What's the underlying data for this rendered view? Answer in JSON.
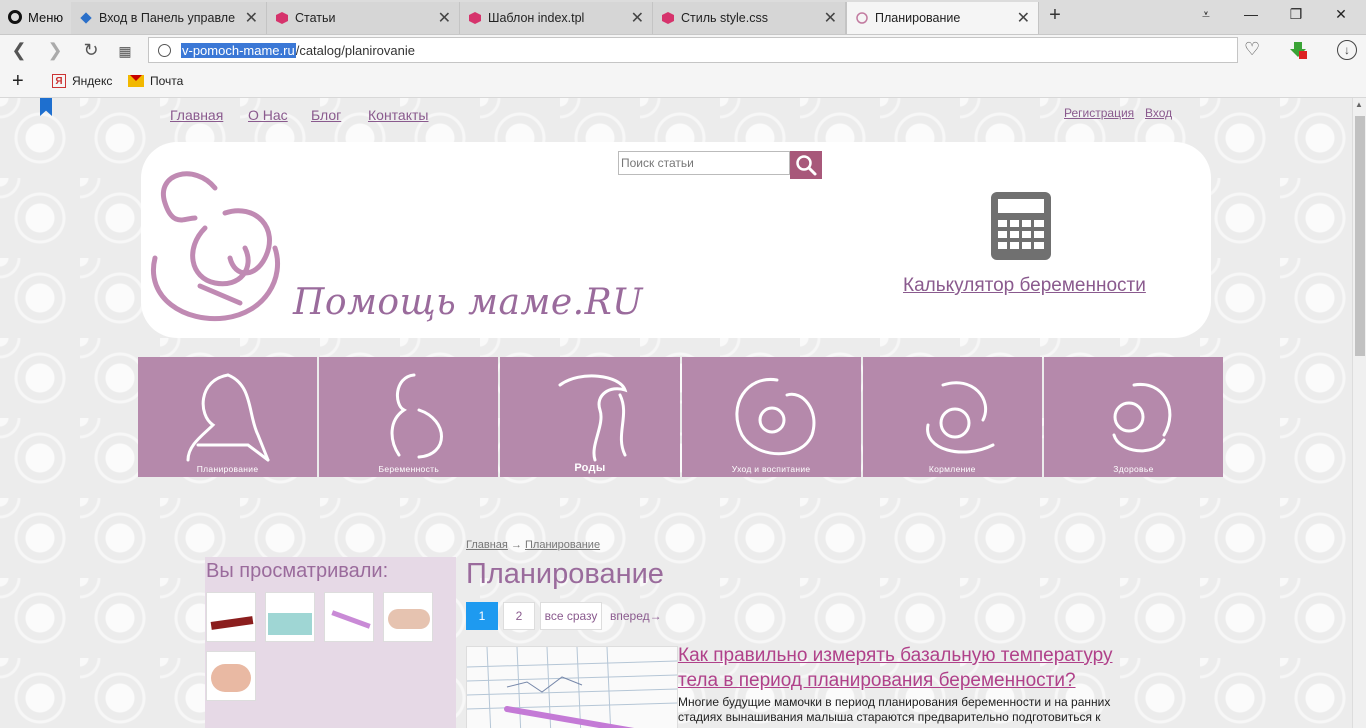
{
  "browser": {
    "menu_label": "Меню",
    "tabs": [
      {
        "label": "Вход в Панель управле",
        "active": false
      },
      {
        "label": "Статьи",
        "active": false
      },
      {
        "label": "Шаблон index.tpl",
        "active": false
      },
      {
        "label": "Стиль style.css",
        "active": false
      },
      {
        "label": "Планирование",
        "active": true
      }
    ],
    "url_host": "v-pomoch-mame.ru",
    "url_path": "/catalog/planirovanie",
    "bookmarks": [
      {
        "label": "Яндекс",
        "icon": "yandex-icon"
      },
      {
        "label": "Почта",
        "icon": "mail-icon"
      }
    ]
  },
  "site": {
    "nav": [
      "Главная",
      "О Нас",
      "Блог",
      "Контакты"
    ],
    "auth": {
      "register": "Регистрация",
      "login": "Вход"
    },
    "search_placeholder": "Поиск статьи",
    "title": "Помощь маме.RU",
    "calculator_link": "Калькулятор беременности",
    "categories": [
      "Планирование",
      "Беременность",
      "Роды",
      "Уход и воспитание",
      "Кормление",
      "Здоровье"
    ],
    "sidebar_title": "Вы просматривали:",
    "breadcrumb": {
      "home": "Главная",
      "sep": "→",
      "current": "Планирование"
    },
    "heading": "Планирование",
    "pagination": {
      "pages": [
        "1",
        "2"
      ],
      "all": "все сразу",
      "next": "вперед→",
      "current": "1"
    },
    "article": {
      "title": "Как правильно измерять базальную температуру тела в период планирования беременности?",
      "excerpt": "Многие будущие мамочки в период планирования беременности и на ранних стадиях вынашивания малыша стараются предварительно подготовиться к"
    }
  },
  "colors": {
    "accent": "#9a6b9c",
    "category_bg": "#b589ab",
    "link": "#8a5a8e",
    "article_link": "#b0418a",
    "page_active": "#1e9af0"
  }
}
